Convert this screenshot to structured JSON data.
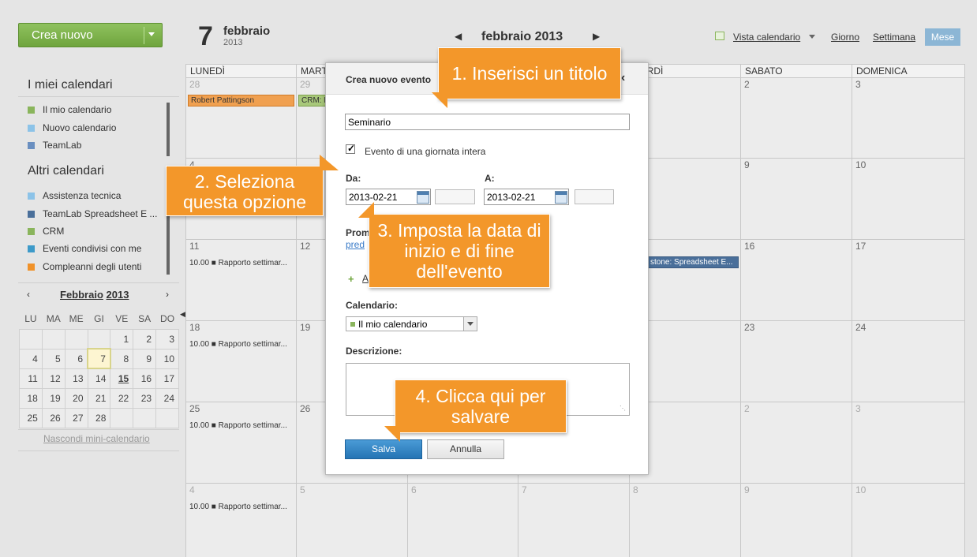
{
  "sidebar": {
    "create_label": "Crea nuovo",
    "my_calendars_title": "I miei calendari",
    "my_calendars": [
      {
        "label": "Il mio calendario",
        "color": "#8ab55c"
      },
      {
        "label": "Nuovo calendario",
        "color": "#8cc3e8"
      },
      {
        "label": "TeamLab",
        "color": "#6a8fc0"
      }
    ],
    "other_calendars_title": "Altri calendari",
    "other_calendars": [
      {
        "label": "Assistenza tecnica",
        "color": "#8cc3e8"
      },
      {
        "label": "TeamLab Spreadsheet E ...",
        "color": "#4a6f9a"
      },
      {
        "label": "CRM",
        "color": "#8ab55c"
      },
      {
        "label": "Eventi condivisi con me",
        "color": "#3d9ac9"
      },
      {
        "label": "Compleanni degli utenti",
        "color": "#f0922a"
      }
    ],
    "mini_calendar": {
      "month": "Febbraio",
      "year": "2013",
      "weekdays": [
        "LU",
        "MA",
        "ME",
        "GI",
        "VE",
        "SA",
        "DO"
      ],
      "weeks": [
        [
          "",
          "",
          "",
          "",
          "1",
          "2",
          "3"
        ],
        [
          "4",
          "5",
          "6",
          "7",
          "8",
          "9",
          "10"
        ],
        [
          "11",
          "12",
          "13",
          "14",
          "15",
          "16",
          "17"
        ],
        [
          "18",
          "19",
          "20",
          "21",
          "22",
          "23",
          "24"
        ],
        [
          "25",
          "26",
          "27",
          "28",
          "",
          "",
          ""
        ]
      ],
      "today": "7",
      "highlight": "15",
      "hide_label": "Nascondi mini-calendario"
    }
  },
  "header": {
    "day_number": "7",
    "day_month": "febbraio",
    "day_year": "2013",
    "month_title": "febbraio 2013",
    "view_calendar_label": "Vista calendario",
    "view_day": "Giorno",
    "view_week": "Settimana",
    "view_month": "Mese"
  },
  "grid": {
    "weekdays": [
      "LUNEDÌ",
      "MART",
      "",
      "",
      "NERDÌ",
      "SABATO",
      "DOMENICA"
    ],
    "rows": [
      [
        "28",
        "29",
        "",
        "",
        "",
        "2",
        "3"
      ],
      [
        "4",
        "",
        "",
        "",
        "",
        "9",
        "10"
      ],
      [
        "11",
        "12",
        "",
        "",
        "",
        "16",
        "17"
      ],
      [
        "18",
        "19",
        "",
        "",
        "",
        "23",
        "24"
      ],
      [
        "25",
        "26",
        "",
        "",
        "",
        "2",
        "3"
      ],
      [
        "4",
        "5",
        "6",
        "7",
        "8",
        "9",
        "10"
      ]
    ],
    "events": {
      "birthday": "Robert Pattingson",
      "crm": "CRM: F",
      "weekly": "10.00 ■ Rapporto settimar...",
      "milestone": "stone: Spreadsheet E..."
    }
  },
  "modal": {
    "title": "Crea nuovo evento",
    "title_value": "Seminario",
    "allday_label": "Evento di una giornata intera",
    "from_label": "Da:",
    "to_label": "A:",
    "from_date": "2013-02-21",
    "to_date": "2013-02-21",
    "reminder_label": "Prom",
    "reminder_link": "pred",
    "add_label": "A",
    "calendar_label": "Calendario:",
    "calendar_value": "Il mio calendario",
    "description_label": "Descrizione:",
    "save_label": "Salva",
    "cancel_label": "Annulla"
  },
  "callouts": {
    "c1": "1. Inserisci un titolo",
    "c2_line1": "2. Seleziona",
    "c2_line2": "questa opzione",
    "c3_line1": "3. Imposta la data di",
    "c3_line2": "inizio e di fine",
    "c3_line3": "dell'evento",
    "c4_line1": "4. Clicca qui per",
    "c4_line2": "salvare"
  }
}
